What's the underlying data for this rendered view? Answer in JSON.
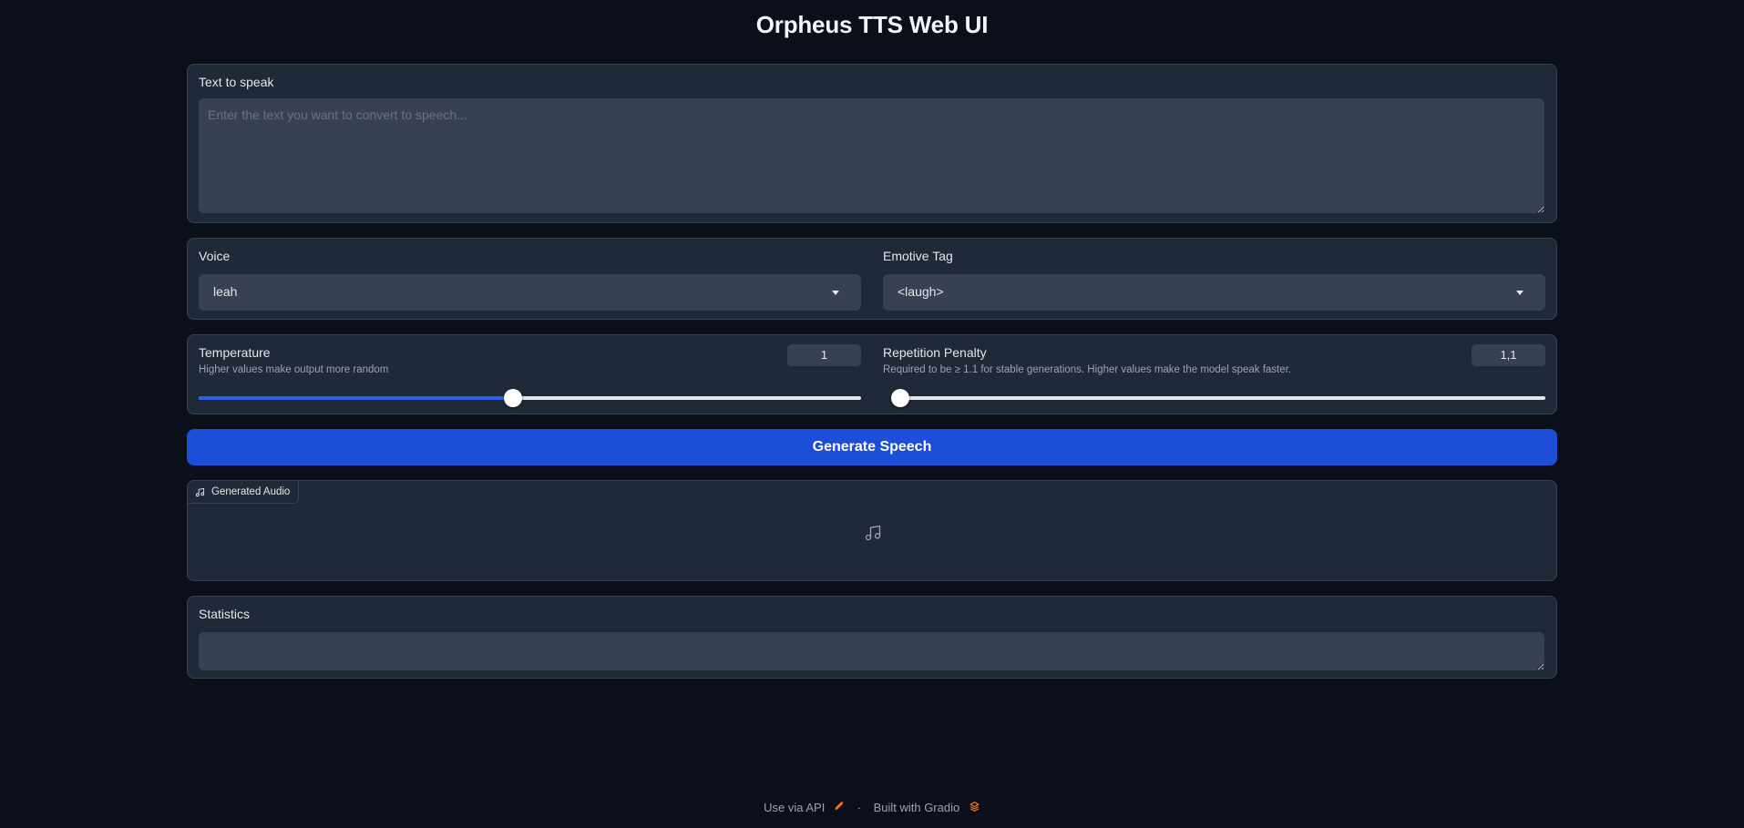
{
  "app": {
    "title": "Orpheus TTS Web UI"
  },
  "text_input": {
    "label": "Text to speak",
    "placeholder": "Enter the text you want to convert to speech...",
    "value": ""
  },
  "voice": {
    "label": "Voice",
    "selected": "leah"
  },
  "emotive": {
    "label": "Emotive Tag",
    "selected": "<laugh>"
  },
  "temperature": {
    "label": "Temperature",
    "info": "Higher values make output more random",
    "value": "1",
    "fraction": 0.475
  },
  "repetition": {
    "label": "Repetition Penalty",
    "info": "Required to be ≥ 1.1 for stable generations. Higher values make the model speak faster.",
    "value": "1,1",
    "fraction": 0.0
  },
  "generate_button": {
    "label": "Generate Speech"
  },
  "audio": {
    "label": "Generated Audio",
    "icon": "music-note-icon"
  },
  "statistics": {
    "label": "Statistics",
    "value": ""
  },
  "footer": {
    "api_link": "Use via API",
    "separator": "·",
    "built_with": "Built with Gradio"
  },
  "colors": {
    "background": "#0b0f19",
    "panel": "#1f2937",
    "input": "#374151",
    "accent": "#1d4ed8",
    "slider_fill": "#2563eb"
  }
}
